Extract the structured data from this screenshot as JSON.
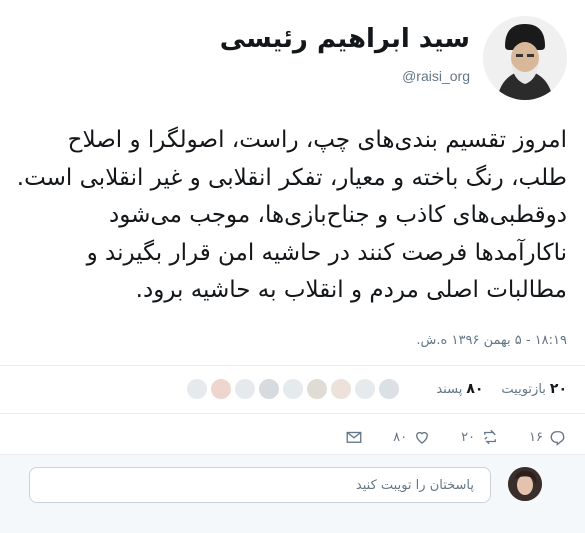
{
  "profile": {
    "name": "سید ابراهیم رئیسی",
    "handle": "@raisi_org"
  },
  "tweet": {
    "text": "امروز تقسیم بندی‌های چپ، راست، اصولگرا و اصلاح طلب، رنگ باخته و معیار، تفکر انقلابی و غیر انقلابی است. دوقطبی‌های کاذب و جناح‌بازی‌ها، موجب می‌شود ناکارآمدها فرصت کنند در حاشیه امن قرار بگیرند و مطالبات اصلی مردم و انقلاب به حاشیه برود.",
    "timestamp": "۱۸:۱۹ - ۵ بهمن ۱۳۹۶ ه.ش."
  },
  "stats": {
    "retweets_count": "۲۰",
    "retweets_label": "بازتوییت",
    "likes_count": "۸۰",
    "likes_label": "پسند"
  },
  "actions": {
    "reply_count": "۱۶",
    "retweet_count": "۲۰",
    "like_count": "۸۰"
  },
  "reply": {
    "placeholder": "پاسختان را تویبت کنید"
  },
  "colors": {
    "text": "#14171a",
    "muted": "#657786",
    "border": "#e6ecf0",
    "reply_bg": "#f5f8fa"
  },
  "icons": {
    "reply": "reply-icon",
    "retweet": "retweet-icon",
    "like": "heart-icon",
    "message": "envelope-icon"
  }
}
